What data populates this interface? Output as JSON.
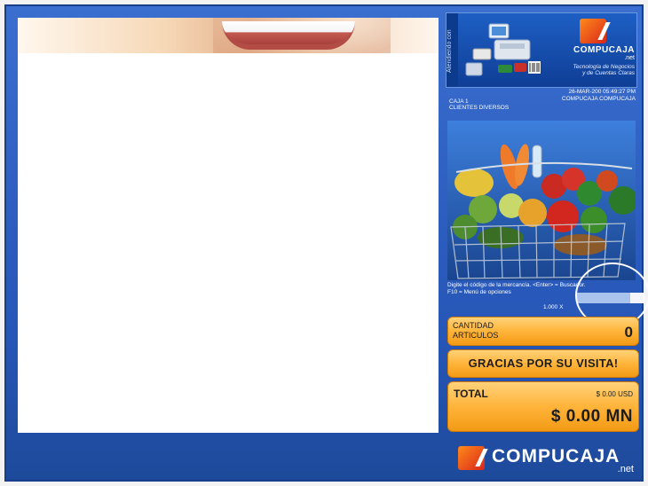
{
  "ad_panel": {
    "side_text": "Atendiendo con",
    "brand": "COMPUCAJA",
    "brand_suffix": ".net",
    "slogan_line1": "Tecnología de Negocios",
    "slogan_line2": "y de Cuentas Claras"
  },
  "status": {
    "datetime": "26-MAR-200  05:49:27 PM",
    "user": "COMPUCAJA COMPUCAJA",
    "register": "CAJA 1",
    "customer": "CLIENTES DIVERSOS"
  },
  "prompt": {
    "line1": "Digite el código de la mercancía. <Enter> = Buscador.",
    "line2": "F10 = Menú de opciones",
    "quantity_prefix": "1.000 X"
  },
  "quantity": {
    "label_line1": "CANTIDAD",
    "label_line2": "ARTICULOS",
    "value": "0"
  },
  "thanks_label": "GRACIAS POR SU VISITA!",
  "total": {
    "label": "TOTAL",
    "usd": "$ 0.00 USD",
    "mn": "$ 0.00 MN"
  },
  "footer": {
    "brand": "COMPUCAJA",
    "suffix": ".net"
  },
  "colors": {
    "background": "#2e5fc1",
    "panel_orange": "#ffb43a",
    "accent_red": "#d9261a"
  }
}
